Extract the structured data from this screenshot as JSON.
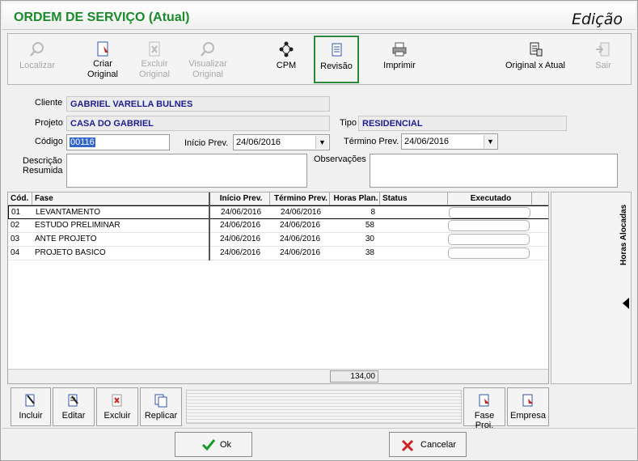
{
  "window": {
    "title": "ORDEM DE SERVIÇO (Atual)",
    "mode": "Edição"
  },
  "toolbar": [
    {
      "id": "localizar",
      "label": "Localizar",
      "icon": "magnifier-icon",
      "enabled": false
    },
    {
      "id": "criar-original",
      "label": "Criar Original",
      "icon": "new-document-icon",
      "enabled": true
    },
    {
      "id": "excluir-original",
      "label": "Excluir Original",
      "icon": "delete-document-icon",
      "enabled": false
    },
    {
      "id": "visualizar-original",
      "label": "Visualizar Original",
      "icon": "view-document-icon",
      "enabled": false
    },
    {
      "id": "cpm",
      "label": "CPM",
      "icon": "network-diagram-icon",
      "enabled": true
    },
    {
      "id": "revisao",
      "label": "Revisão",
      "icon": "list-document-icon",
      "enabled": true,
      "selected": true
    },
    {
      "id": "imprimir",
      "label": "Imprimir",
      "icon": "printer-icon",
      "enabled": true
    },
    {
      "id": "original-x-atual",
      "label": "Original x Atual",
      "icon": "compare-icon",
      "enabled": true
    },
    {
      "id": "sair",
      "label": "Sair",
      "icon": "exit-door-icon",
      "enabled": false
    }
  ],
  "form": {
    "cliente_label": "Cliente",
    "cliente_value": "GABRIEL VARELLA BULNES",
    "projeto_label": "Projeto",
    "projeto_value": "CASA DO GABRIEL",
    "tipo_label": "Tipo",
    "tipo_value": "RESIDENCIAL",
    "codigo_label": "Código",
    "codigo_value": "00116",
    "inicio_label": "Início Prev.",
    "inicio_value": "24/06/2016",
    "termino_label": "Término Prev.",
    "termino_value": "24/06/2016",
    "descricao_label_1": "Descrição",
    "descricao_label_2": "Resumida",
    "observacoes_label": "Observações"
  },
  "grid": {
    "columns": [
      "Cód.",
      "Fase",
      "Início Prev.",
      "Término Prev.",
      "Horas Plan.",
      "Status",
      "Executado"
    ],
    "rows": [
      {
        "cod": "01",
        "fase": "LEVANTAMENTO",
        "inicio": "24/06/2016",
        "termino": "24/06/2016",
        "horas": "8",
        "status": ""
      },
      {
        "cod": "02",
        "fase": "ESTUDO PRELIMINAR",
        "inicio": "24/06/2016",
        "termino": "24/06/2016",
        "horas": "58",
        "status": ""
      },
      {
        "cod": "03",
        "fase": "ANTE PROJETO",
        "inicio": "24/06/2016",
        "termino": "24/06/2016",
        "horas": "30",
        "status": ""
      },
      {
        "cod": "04",
        "fase": "PROJETO BASICO",
        "inicio": "24/06/2016",
        "termino": "24/06/2016",
        "horas": "38",
        "status": ""
      }
    ],
    "total_horas": "134,00"
  },
  "side_panel": {
    "label": "Horas Alocadas"
  },
  "bottom_buttons": {
    "incluir": "Incluir",
    "editar": "Editar",
    "excluir": "Excluir",
    "replicar": "Replicar",
    "fase_proj": "Fase Proj.",
    "empresa": "Empresa"
  },
  "footer": {
    "ok": "Ok",
    "cancelar": "Cancelar"
  },
  "colors": {
    "title_green": "#1a8a2a",
    "value_blue": "#1d1d8f",
    "selected_border": "#2a8a3a"
  }
}
